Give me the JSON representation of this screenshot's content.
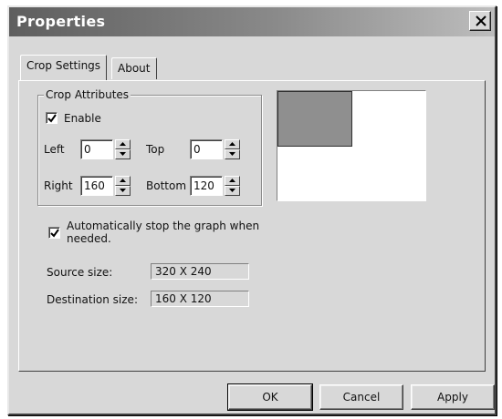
{
  "window": {
    "title": "Properties"
  },
  "tabs": [
    {
      "label": "Crop Settings",
      "active": true
    },
    {
      "label": "About",
      "active": false
    }
  ],
  "crop_attributes": {
    "group_label": "Crop Attributes",
    "enable": {
      "label": "Enable",
      "checked": true
    },
    "left": {
      "label": "Left",
      "value": "0"
    },
    "top": {
      "label": "Top",
      "value": "0"
    },
    "right": {
      "label": "Right",
      "value": "160"
    },
    "bottom": {
      "label": "Bottom",
      "value": "120"
    }
  },
  "auto_stop": {
    "label_line1": "Automatically stop the graph when",
    "label_line2": "needed.",
    "checked": true
  },
  "source_size": {
    "label": "Source size:",
    "value": "320 X 240"
  },
  "destination_size": {
    "label": "Destination size:",
    "value": "160 X 120"
  },
  "buttons": {
    "ok": "OK",
    "cancel": "Cancel",
    "apply": "Apply"
  },
  "icons": {
    "close": "close-icon",
    "check": "checkmark-icon",
    "spin_up": "arrow-up-icon",
    "spin_down": "arrow-down-icon"
  },
  "colors": {
    "title_dark": "#5e5e5e",
    "face": "#d8d8d8",
    "crop_fill": "#8f8f8f"
  }
}
